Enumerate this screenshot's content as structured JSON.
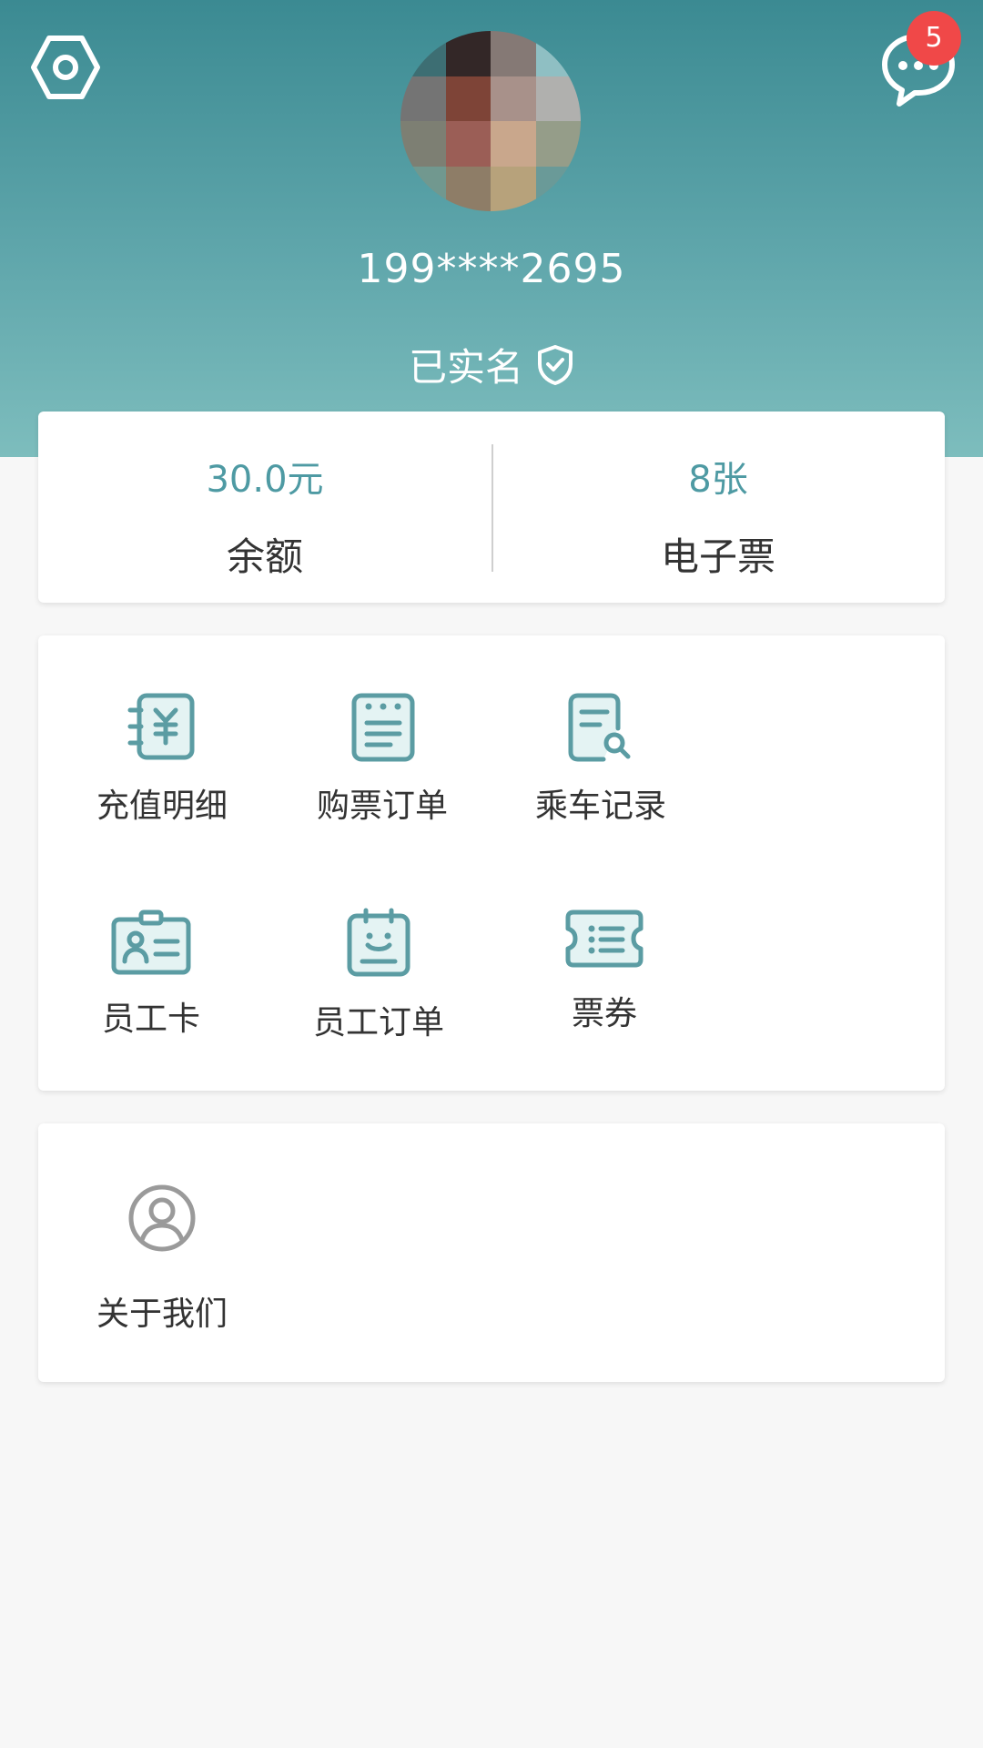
{
  "header": {
    "phone": "199****2695",
    "verified_label": "已实名",
    "message_badge": "5",
    "gradient": [
      "#3b8a92",
      "#7dbdbd"
    ]
  },
  "icons": {
    "settings": "hexagon-settings-icon",
    "messages": "chat-bubble-icon",
    "verified": "shield-check-icon"
  },
  "stats": {
    "balance": {
      "value": "30.0元",
      "label": "余额"
    },
    "etickets": {
      "value": "8张",
      "label": "电子票"
    }
  },
  "menu": {
    "items": [
      {
        "label": "充值明细",
        "icon": "recharge-detail-icon"
      },
      {
        "label": "购票订单",
        "icon": "ticket-order-icon"
      },
      {
        "label": "乘车记录",
        "icon": "ride-record-icon"
      },
      {
        "label": "员工卡",
        "icon": "employee-card-icon"
      },
      {
        "label": "员工订单",
        "icon": "employee-order-icon"
      },
      {
        "label": "票券",
        "icon": "coupon-icon"
      }
    ]
  },
  "about": {
    "label": "关于我们",
    "icon": "user-circle-icon"
  },
  "colors": {
    "accent": "#4e9aa3",
    "badge": "#f04848"
  }
}
